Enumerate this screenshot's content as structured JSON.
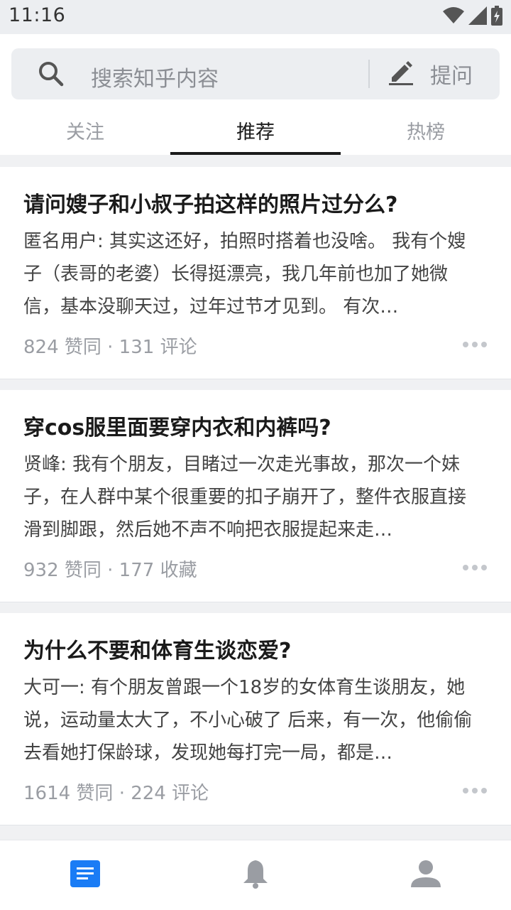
{
  "status_bar": {
    "time": "11:16",
    "icons": [
      "wifi-icon",
      "signal-icon",
      "battery-icon"
    ]
  },
  "search": {
    "placeholder": "搜索知乎内容",
    "ask_label": "提问"
  },
  "tabs": [
    {
      "label": "关注",
      "active": false
    },
    {
      "label": "推荐",
      "active": true
    },
    {
      "label": "热榜",
      "active": false
    }
  ],
  "feed": [
    {
      "title": "请问嫂子和小叔子拍这样的照片过分么?",
      "excerpt": "匿名用户: 其实这还好，拍照时搭着也没啥。 我有个嫂子（表哥的老婆）长得挺漂亮，我几年前也加了她微信，基本没聊天过，过年过节才见到。 有次…",
      "meta": "824 赞同 · 131 评论"
    },
    {
      "title": "穿cos服里面要穿内衣和内裤吗?",
      "excerpt": "贤峰: 我有个朋友，目睹过一次走光事故，那次一个妹子，在人群中某个很重要的扣子崩开了，整件衣服直接滑到脚跟，然后她不声不响把衣服提起来走…",
      "meta": "932 赞同 · 177 收藏"
    },
    {
      "title": "为什么不要和体育生谈恋爱?",
      "excerpt": "大可一: 有个朋友曾跟一个18岁的女体育生谈朋友，她说，运动量太大了，不小心破了 后来，有一次，他偷偷去看她打保龄球，发现她每打完一局，都是…",
      "meta": "1614 赞同 · 224 评论"
    }
  ],
  "bottom_nav": [
    {
      "icon": "home-feed-icon",
      "active": true
    },
    {
      "icon": "bell-icon",
      "active": false
    },
    {
      "icon": "profile-icon",
      "active": false
    }
  ],
  "colors": {
    "accent": "#1a7cf5",
    "text_primary": "#1a1a1a",
    "text_secondary": "#9a9da3",
    "background": "#f0f1f3"
  }
}
